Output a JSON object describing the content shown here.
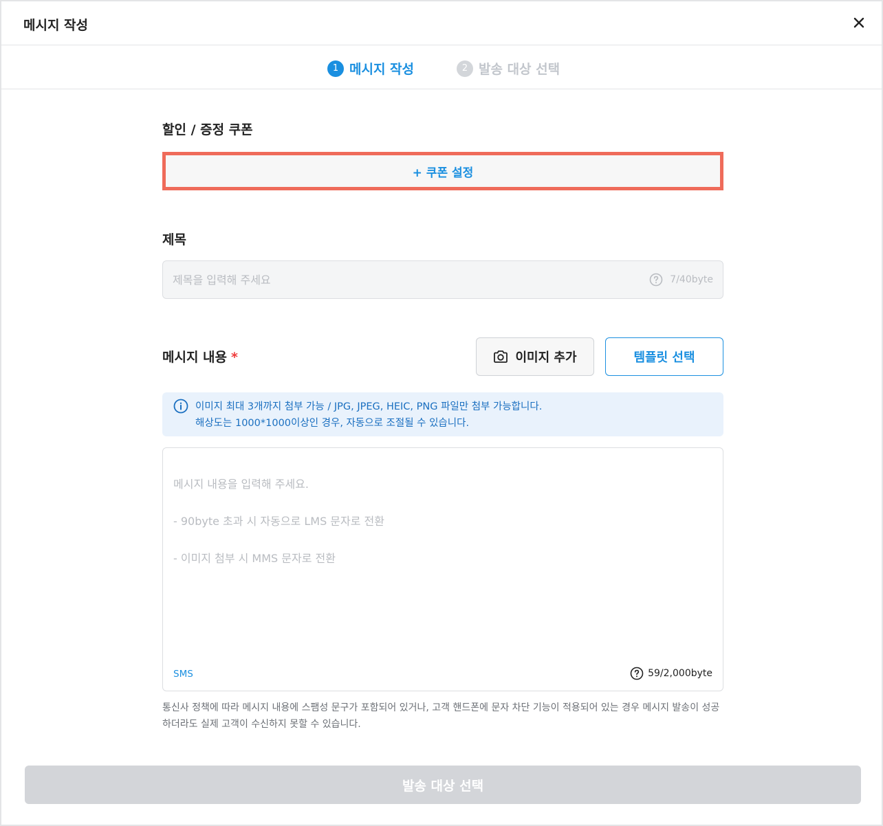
{
  "header": {
    "title": "메시지 작성",
    "close_icon": "close-icon"
  },
  "steps": [
    {
      "number": "1",
      "label": "메시지 작성",
      "active": true
    },
    {
      "number": "2",
      "label": "발송 대상 선택",
      "active": false
    }
  ],
  "coupon": {
    "label": "할인 / 증정 쿠폰",
    "button_label": "+ 쿠폰 설정"
  },
  "subject": {
    "label": "제목",
    "placeholder": "제목을 입력해 주세요",
    "value": "",
    "counter": "7/40byte"
  },
  "message": {
    "label": "메시지 내용",
    "required_mark": "*",
    "add_image_label": "이미지 추가",
    "template_label": "템플릿 선택",
    "info_line1": "이미지 최대 3개까지 첨부 가능 / JPG, JPEG, HEIC, PNG 파일만 첨부 가능합니다.",
    "info_line2": "해상도는 1000*1000이상인 경우, 자동으로 조절될 수 있습니다.",
    "placeholder_line1": "메시지 내용을 입력해 주세요.",
    "placeholder_line2": "- 90byte 초과 시 자동으로 LMS 문자로 전환",
    "placeholder_line3": "- 이미지 첨부 시 MMS 문자로 전환",
    "type_tag": "SMS",
    "byte_counter": "59/2,000byte"
  },
  "notice": "통신사 정책에 따라 메시지 내용에 스팸성 문구가 포함되어 있거나, 고객 핸드폰에 문자 차단 기능이 적용되어 있는 경우 메시지 발송이 성공하더라도 실제 고객이 수신하지 못할 수 있습니다.",
  "submit": {
    "label": "발송 대상 선택",
    "enabled": false
  },
  "colors": {
    "accent": "#1a8fe0",
    "highlight_border": "#ef6b5a",
    "required": "#ef3b3b",
    "disabled_button": "#d3d5d9"
  }
}
